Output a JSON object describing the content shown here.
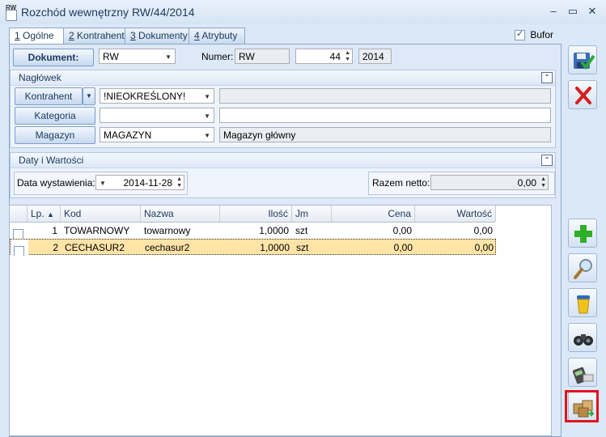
{
  "window": {
    "icon_text": "RW",
    "title": "Rozchód wewnętrzny RW/44/2014"
  },
  "tabs": [
    {
      "num": "1",
      "label": " Ogólne"
    },
    {
      "num": "2",
      "label": " Kontrahent"
    },
    {
      "num": "3",
      "label": " Dokumenty"
    },
    {
      "num": "4",
      "label": " Atrybuty"
    }
  ],
  "bufor": {
    "label": "Bufor",
    "checked": true
  },
  "document": {
    "button_label": "Dokument:",
    "type_value": "RW",
    "numer_label": "Numer:",
    "numer_series": "RW",
    "numer_value": "44",
    "numer_year": "2014"
  },
  "naglowek": {
    "title": "Nagłówek",
    "kontrahent_label": "Kontrahent",
    "kontrahent_value": "!NIEOKREŚLONY!",
    "kontrahent_desc": "",
    "kategoria_label": "Kategoria",
    "kategoria_value": "",
    "kategoria_desc": "",
    "magazyn_label": "Magazyn",
    "magazyn_value": "MAGAZYN",
    "magazyn_desc": "Magazyn główny"
  },
  "daty": {
    "title": "Daty i Wartości",
    "data_label": "Data wystawienia:",
    "data_value": "2014-11-28",
    "razem_label": "Razem netto:",
    "razem_value": "0,00"
  },
  "table": {
    "columns": [
      "Lp.",
      "Kod",
      "Nazwa",
      "Ilość",
      "Jm",
      "Cena",
      "Wartość"
    ],
    "rows": [
      {
        "lp": "1",
        "kod": "TOWARNOWY",
        "nazwa": "towarnowy",
        "ilosc": "1,0000",
        "jm": "szt",
        "cena": "0,00",
        "wartosc": "0,00"
      },
      {
        "lp": "2",
        "kod": "CECHASUR2",
        "nazwa": "cechasur2",
        "ilosc": "1,0000",
        "jm": "szt",
        "cena": "0,00",
        "wartosc": "0,00"
      }
    ],
    "selected_row": 2
  },
  "side_buttons": [
    "save-icon",
    "cancel-icon",
    "add-icon",
    "edit-magnifier-icon",
    "delete-bin-icon",
    "binoculars-icon",
    "payment-terminal-icon",
    "warehouse-boxes-icon"
  ],
  "colors": {
    "selected_row": "#ffe4a8",
    "highlight": "#e0141e"
  }
}
